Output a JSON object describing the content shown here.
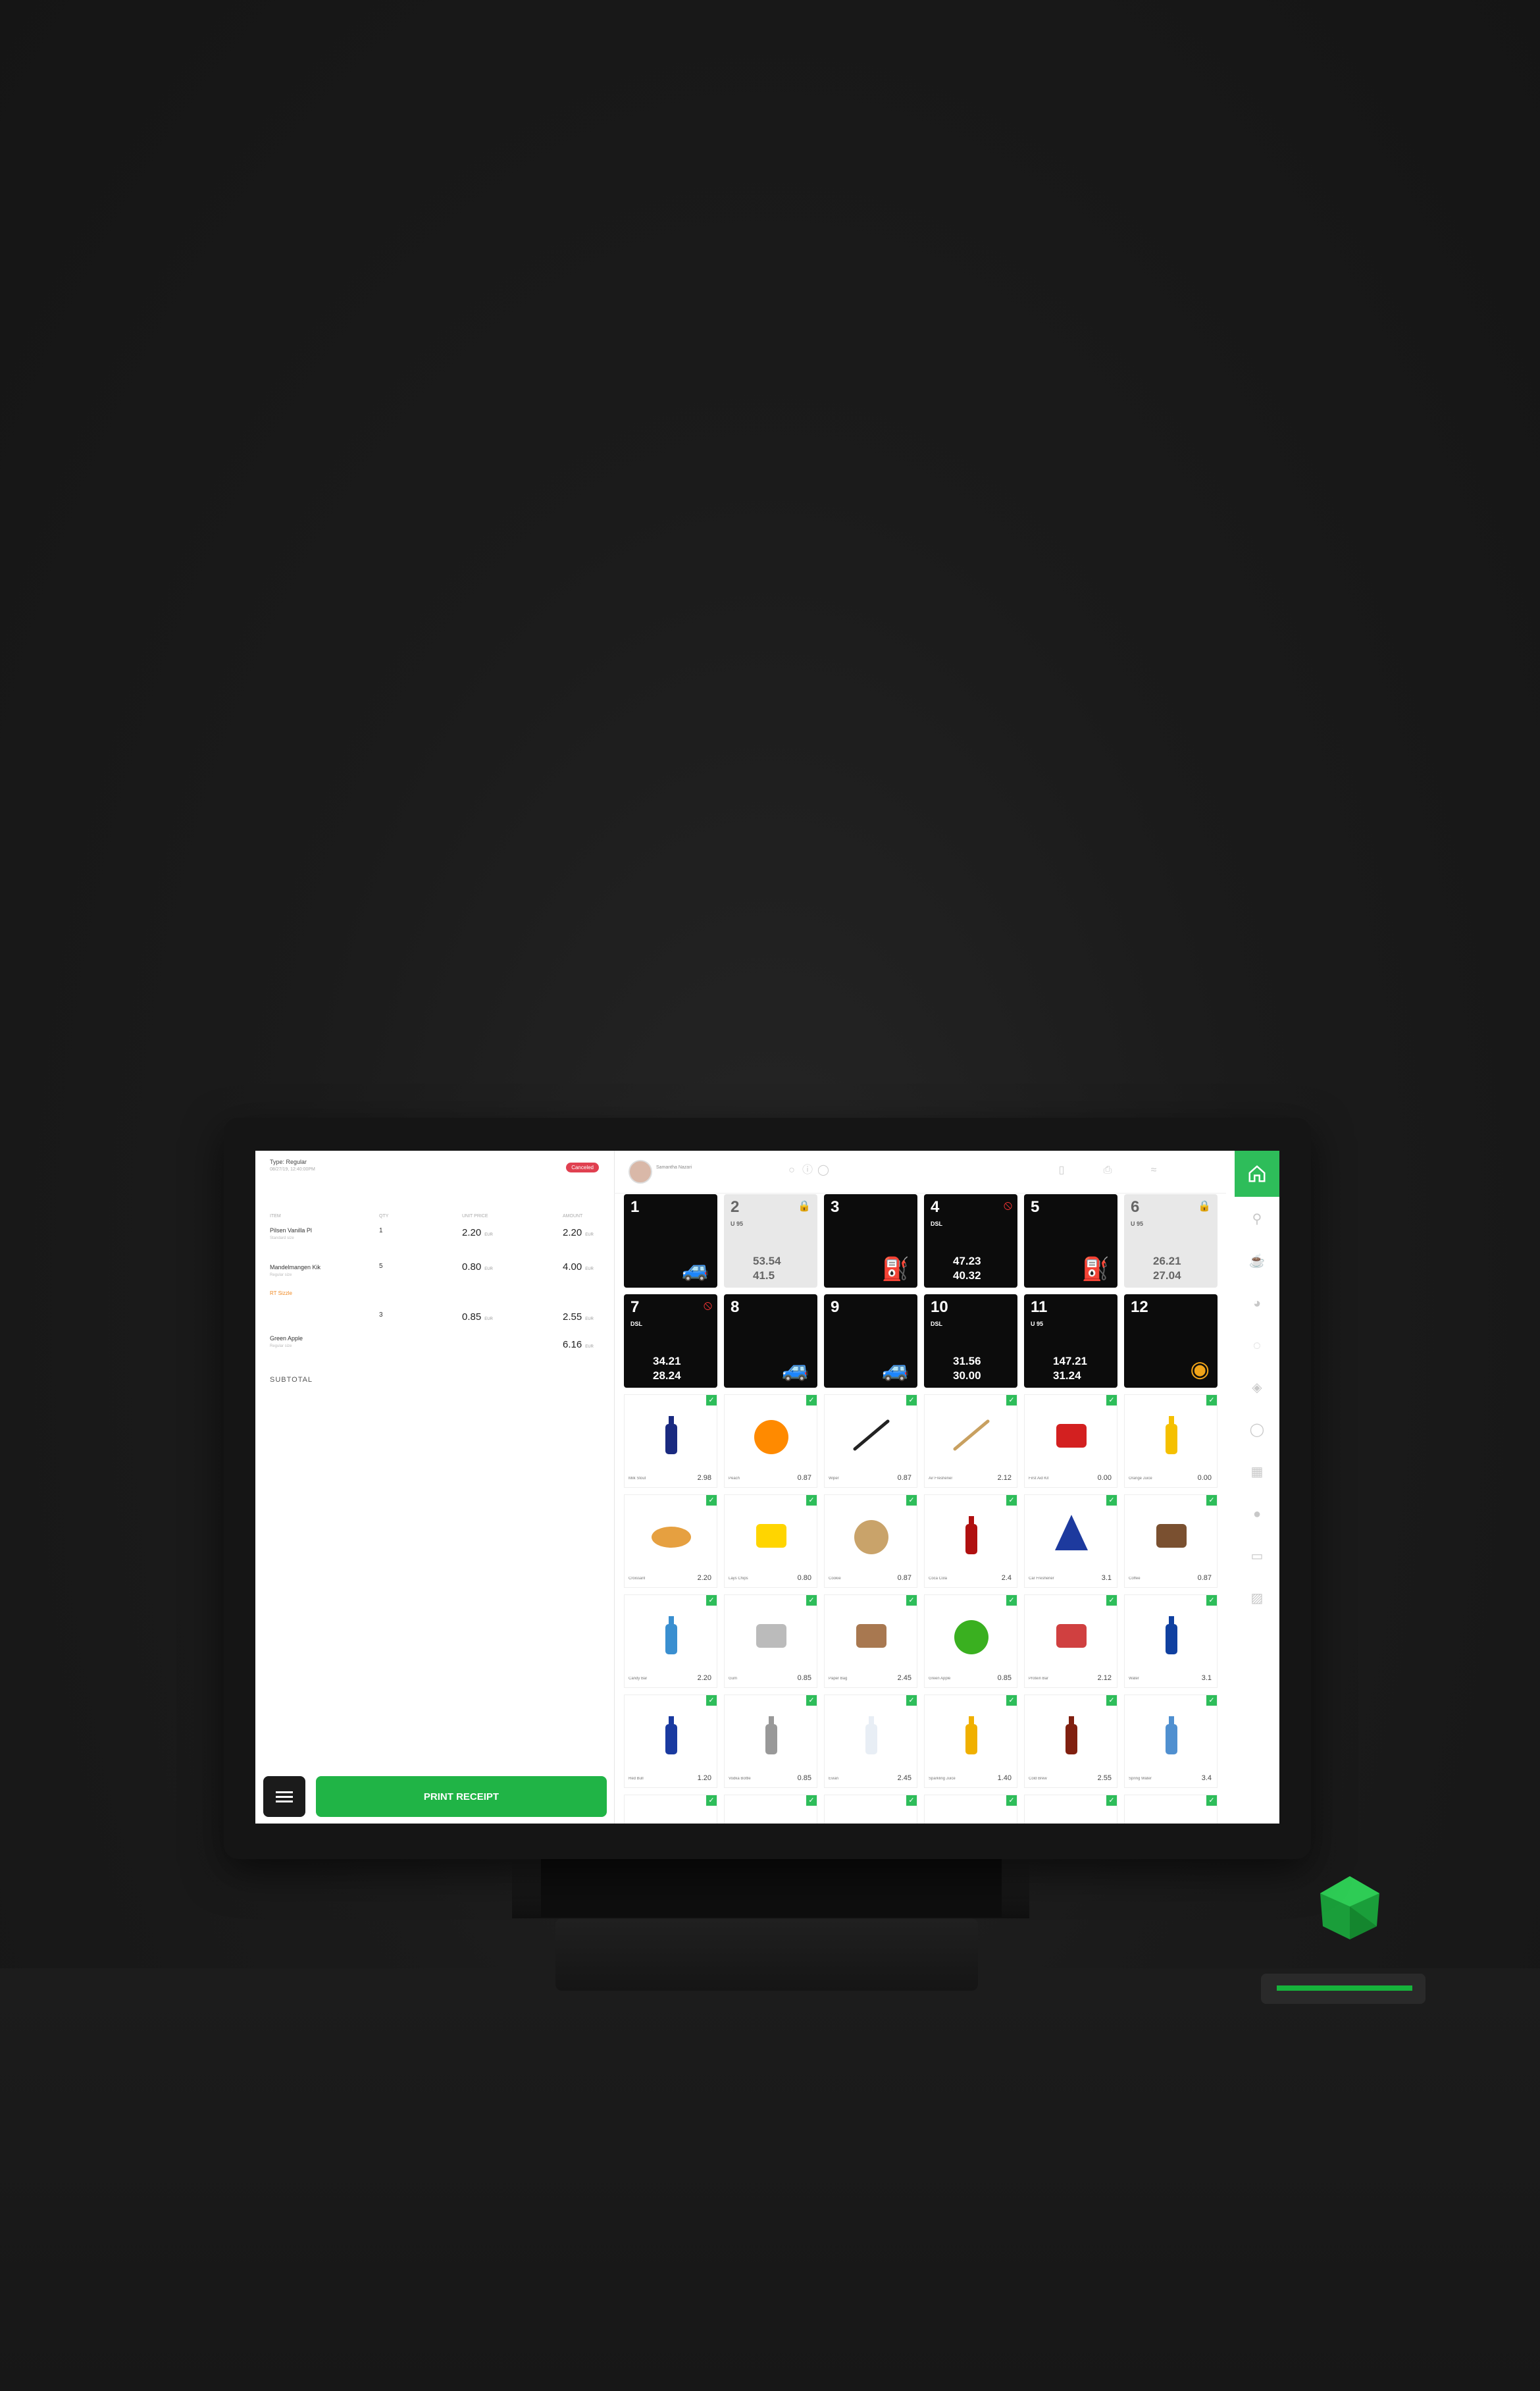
{
  "colors": {
    "accent": "#2ebd5a",
    "pump_dark": "#0c0c0c",
    "pump_disabled": "#e8e8e8",
    "alert": "#e33333",
    "car": "#f0a419"
  },
  "order": {
    "type_label": "Type: Regular",
    "date_label": "08/27/19, 12:40:00PM",
    "status_badge": "Canceled",
    "columns": {
      "item": "ITEM",
      "qty": "QTY",
      "price": "UNIT PRICE",
      "amount": "AMOUNT"
    },
    "rows": [
      {
        "name": "Pilsen Vanilla Pl",
        "note": "Standard size",
        "extra": "",
        "qty": "1",
        "price": "2.20",
        "total": "2.20"
      },
      {
        "name": "Mandelmangen Kik",
        "note": "Regular size",
        "extra": "RT Sizzle",
        "qty": "5",
        "price": "0.80",
        "total": "4.00"
      },
      {
        "name": "",
        "note": "",
        "extra": "",
        "qty": "3",
        "price": "0.85",
        "total": "2.55"
      },
      {
        "name": "Green Apple",
        "note": "Regular size",
        "extra": "",
        "qty": "",
        "price": "",
        "total": "6.16"
      }
    ],
    "unit": "EUR",
    "subtotal_label": "SUBTOTAL",
    "print_label": "PRINT RECEIPT"
  },
  "topbar": {
    "user_name": "Samantha Nazari"
  },
  "pumps": [
    {
      "num": "1",
      "dark": true,
      "fuel": "",
      "v1": "",
      "v2": "",
      "icon": "car-icon",
      "lock": false,
      "alert": false
    },
    {
      "num": "2",
      "dark": false,
      "fuel": "U 95",
      "v1": "53.54",
      "v2": "41.5",
      "icon": "",
      "lock": true,
      "alert": false
    },
    {
      "num": "3",
      "dark": true,
      "fuel": "",
      "v1": "",
      "v2": "",
      "icon": "no-fuel-icon",
      "lock": false,
      "alert": false
    },
    {
      "num": "4",
      "dark": true,
      "fuel": "DSL",
      "v1": "47.23",
      "v2": "40.32",
      "icon": "",
      "lock": false,
      "alert": true
    },
    {
      "num": "5",
      "dark": true,
      "fuel": "",
      "v1": "",
      "v2": "",
      "icon": "fuel-pump-icon",
      "lock": false,
      "alert": false
    },
    {
      "num": "6",
      "dark": false,
      "fuel": "U 95",
      "v1": "26.21",
      "v2": "27.04",
      "icon": "",
      "lock": true,
      "alert": false
    },
    {
      "num": "7",
      "dark": true,
      "fuel": "DSL",
      "v1": "34.21",
      "v2": "28.24",
      "icon": "",
      "lock": false,
      "alert": true
    },
    {
      "num": "8",
      "dark": true,
      "fuel": "",
      "v1": "",
      "v2": "",
      "icon": "car-icon",
      "lock": false,
      "alert": false
    },
    {
      "num": "9",
      "dark": true,
      "fuel": "",
      "v1": "",
      "v2": "",
      "icon": "car-icon",
      "lock": false,
      "alert": false
    },
    {
      "num": "10",
      "dark": true,
      "fuel": "DSL",
      "v1": "31.56",
      "v2": "30.00",
      "icon": "",
      "lock": false,
      "alert": false
    },
    {
      "num": "11",
      "dark": true,
      "fuel": "U 95",
      "v1": "147.21",
      "v2": "31.24",
      "icon": "",
      "lock": false,
      "alert": false
    },
    {
      "num": "12",
      "dark": true,
      "fuel": "",
      "v1": "",
      "v2": "",
      "icon": "payment-icon",
      "lock": false,
      "alert": false
    }
  ],
  "products": [
    {
      "name": "Milk Stout",
      "price": "2.98",
      "icon": "bottle-icon",
      "color": "#1a2a80"
    },
    {
      "name": "Peach",
      "price": "0.87",
      "icon": "orange-icon",
      "color": "#ff8a00"
    },
    {
      "name": "Wiper",
      "price": "0.87",
      "icon": "wiper-icon",
      "color": "#222222"
    },
    {
      "name": "Air Freshener",
      "price": "2.12",
      "icon": "brush-icon",
      "color": "#c8a060"
    },
    {
      "name": "First Aid Kit",
      "price": "0.00",
      "icon": "first-aid-icon",
      "color": "#d32020"
    },
    {
      "name": "Orange Juice",
      "price": "0.00",
      "icon": "juice-bottle-icon",
      "color": "#f5c000"
    },
    {
      "name": "Croissant",
      "price": "2.20",
      "icon": "croissant-icon",
      "color": "#e6a040"
    },
    {
      "name": "Lays Chips",
      "price": "0.80",
      "icon": "chips-icon",
      "color": "#ffd500"
    },
    {
      "name": "Cookie",
      "price": "0.87",
      "icon": "cookie-icon",
      "color": "#c9a36a"
    },
    {
      "name": "Coca Cola",
      "price": "2.4",
      "icon": "cola-icon",
      "color": "#b01010"
    },
    {
      "name": "Car Freshener",
      "price": "3.1",
      "icon": "tree-icon",
      "color": "#1d3a9e"
    },
    {
      "name": "Coffee",
      "price": "0.87",
      "icon": "coffee-icon",
      "color": "#7a5030"
    },
    {
      "name": "Candy Bar",
      "price": "2.20",
      "icon": "candy-icon",
      "color": "#3a8fd0"
    },
    {
      "name": "Gum",
      "price": "0.85",
      "icon": "gum-icon",
      "color": "#bbbbbb"
    },
    {
      "name": "Paper Bag",
      "price": "2.45",
      "icon": "bag-icon",
      "color": "#a87850"
    },
    {
      "name": "Green Apple",
      "price": "0.85",
      "icon": "apple-icon",
      "color": "#3ab020"
    },
    {
      "name": "Protein Bar",
      "price": "2.12",
      "icon": "bar-icon",
      "color": "#d04040"
    },
    {
      "name": "Water",
      "price": "3.1",
      "icon": "water-bottle-icon",
      "color": "#1040a0"
    },
    {
      "name": "Red Bull",
      "price": "1.20",
      "icon": "can-icon",
      "color": "#1a3aa0"
    },
    {
      "name": "Vodka Bottle",
      "price": "0.85",
      "icon": "slim-bottle-icon",
      "color": "#999999"
    },
    {
      "name": "Evian",
      "price": "2.45",
      "icon": "water-icon",
      "color": "#e8eef5"
    },
    {
      "name": "Sparkling Juice",
      "price": "1.40",
      "icon": "juice-icon",
      "color": "#f0b000"
    },
    {
      "name": "Cold Brew",
      "price": "2.55",
      "icon": "dark-bottle-icon",
      "color": "#802010"
    },
    {
      "name": "Spring Water",
      "price": "3.4",
      "icon": "small-water-icon",
      "color": "#5090d0"
    }
  ]
}
